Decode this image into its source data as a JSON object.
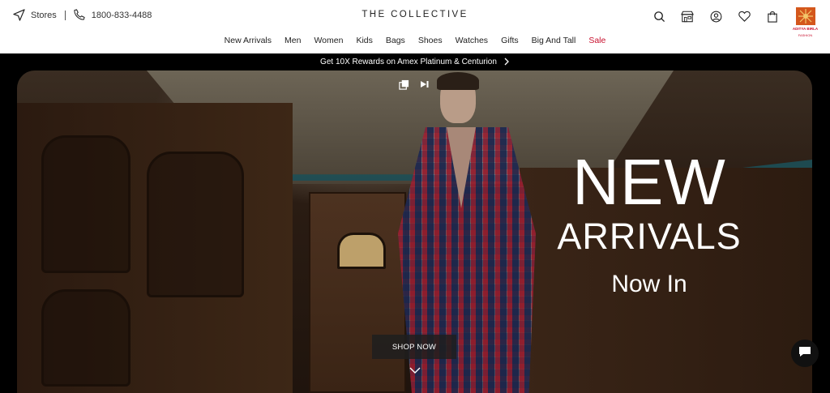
{
  "header": {
    "stores_label": "Stores",
    "phone": "1800-833-4488",
    "brand": "THE COLLECTIVE",
    "icons": [
      "search-icon",
      "store-icon",
      "account-icon",
      "wishlist-heart-icon",
      "cart-bag-icon"
    ],
    "partner_logo": {
      "line1": "ADITYA BIRLA",
      "line2": "FASHION"
    }
  },
  "nav": {
    "items": [
      {
        "label": "New Arrivals"
      },
      {
        "label": "Men"
      },
      {
        "label": "Women"
      },
      {
        "label": "Kids"
      },
      {
        "label": "Bags"
      },
      {
        "label": "Shoes"
      },
      {
        "label": "Watches"
      },
      {
        "label": "Gifts"
      },
      {
        "label": "Big And Tall"
      },
      {
        "label": "Sale"
      }
    ],
    "sale_color": "#c8102e"
  },
  "promo": {
    "text": "Get 10X Rewards on Amex Platinum & Centurion"
  },
  "hero": {
    "headline_1": "NEW",
    "headline_2": "ARRIVALS",
    "headline_3": "Now In",
    "cta": "SHOP NOW",
    "media_controls": [
      "gallery-icon",
      "next-video-icon"
    ]
  },
  "colors": {
    "promo_bg": "#000000",
    "hero_bg": "#000000",
    "text": "#222222"
  }
}
